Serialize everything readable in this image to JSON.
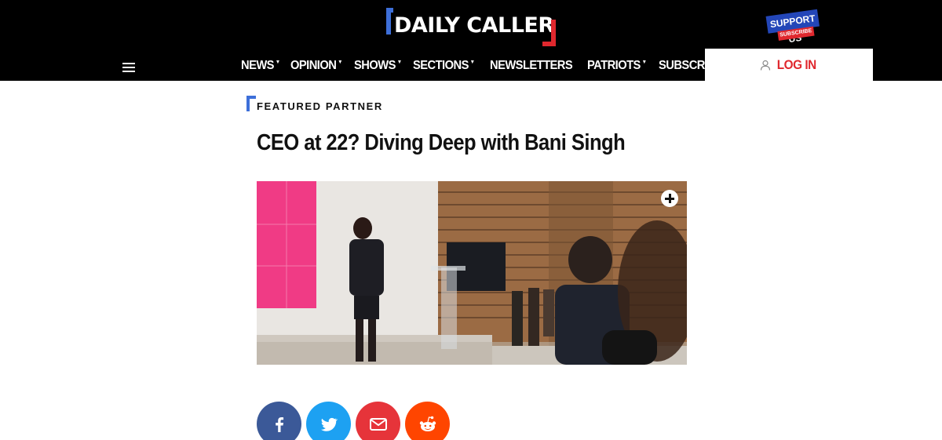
{
  "header": {
    "logo_text": "DAILY CALLER",
    "support": {
      "line1": "SUPPORT US",
      "line2": "SUBSCRIBE"
    },
    "nav": [
      {
        "label": "NEWS",
        "has_dropdown": true
      },
      {
        "label": "OPINION",
        "has_dropdown": true
      },
      {
        "label": "SHOWS",
        "has_dropdown": true
      },
      {
        "label": "SECTIONS",
        "has_dropdown": true
      },
      {
        "label": "NEWSLETTERS",
        "has_dropdown": false
      },
      {
        "label": "PATRIOTS",
        "has_dropdown": true
      },
      {
        "label": "SUBSCRIBE",
        "has_dropdown": false
      }
    ],
    "login_label": "LOG IN"
  },
  "article": {
    "category": "FEATURED PARTNER",
    "title": "CEO at 22? Diving Deep with Bani Singh"
  },
  "share": [
    {
      "network": "facebook",
      "icon": "facebook-icon"
    },
    {
      "network": "twitter",
      "icon": "twitter-icon"
    },
    {
      "network": "email",
      "icon": "email-icon"
    },
    {
      "network": "reddit",
      "icon": "reddit-icon"
    }
  ],
  "colors": {
    "accent_blue": "#3d6fd9",
    "accent_red": "#e0282e",
    "header_bg": "#000000",
    "facebook": "#3b5998",
    "twitter": "#1da1f2",
    "email": "#e6343a",
    "reddit": "#ff4500"
  }
}
